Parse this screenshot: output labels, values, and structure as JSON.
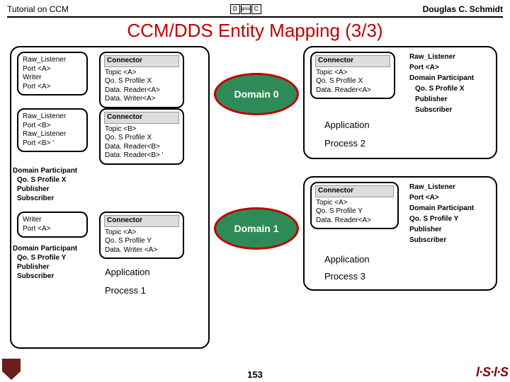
{
  "header": {
    "left": "Tutorial on CCM",
    "right": "Douglas C. Schmidt"
  },
  "title": "CCM/DDS Entity Mapping (3/3)",
  "page_num": "153",
  "left_card1": [
    "Raw_Listener",
    "Port <A>",
    "Writer",
    "Port <A>"
  ],
  "left_card2": [
    "Raw_Listener",
    "Port <B>",
    "Raw_Listener",
    "Port <B> '"
  ],
  "left_card3": [
    "Domain Participant",
    "Qo. S Profile X",
    "Publisher",
    "Subscriber"
  ],
  "left_card4": [
    "Writer",
    "Port <A>"
  ],
  "left_card5": [
    "Domain Participant",
    "Qo. S Profile Y",
    "Publisher",
    "Subscriber"
  ],
  "conn1": {
    "hdr": "Connector",
    "lines": [
      "Topic <A>",
      " Qo. S Profile X",
      " Data. Reader<A>",
      " Data. Writer<A>"
    ]
  },
  "conn2": {
    "hdr": "Connector",
    "lines": [
      "Topic <B>",
      " Qo. S Profile X",
      " Data. Reader<B>",
      " Data. Reader<B> '"
    ]
  },
  "conn3": {
    "hdr": "Connector",
    "lines": [
      "Topic <A>",
      " Qo. S Profile Y",
      " Data. Writer <A>"
    ]
  },
  "conn4": {
    "hdr": "Connector",
    "lines": [
      "Topic <A>",
      " Qo. S Profile X",
      " Data. Reader<A>"
    ]
  },
  "conn5": {
    "hdr": "Connector",
    "lines": [
      "Topic <A>",
      " Qo. S Profile Y",
      " Data. Reader<A>"
    ]
  },
  "right1": [
    "Raw_Listener",
    "Port <A>",
    " ",
    "Domain Participant",
    "Qo. S Profile X",
    "Publisher",
    "Subscriber"
  ],
  "right2": [
    "Raw_Listener",
    "Port <A>",
    " ",
    "Domain Participant",
    " Qo. S Profile Y",
    " Publisher",
    " Subscriber"
  ],
  "domain0": "Domain 0",
  "domain1": "Domain 1",
  "app1": "Application",
  "proc1": "Process 1",
  "app2": "Application",
  "proc2": "Process 2",
  "app3": "Application",
  "proc3": "Process 3"
}
